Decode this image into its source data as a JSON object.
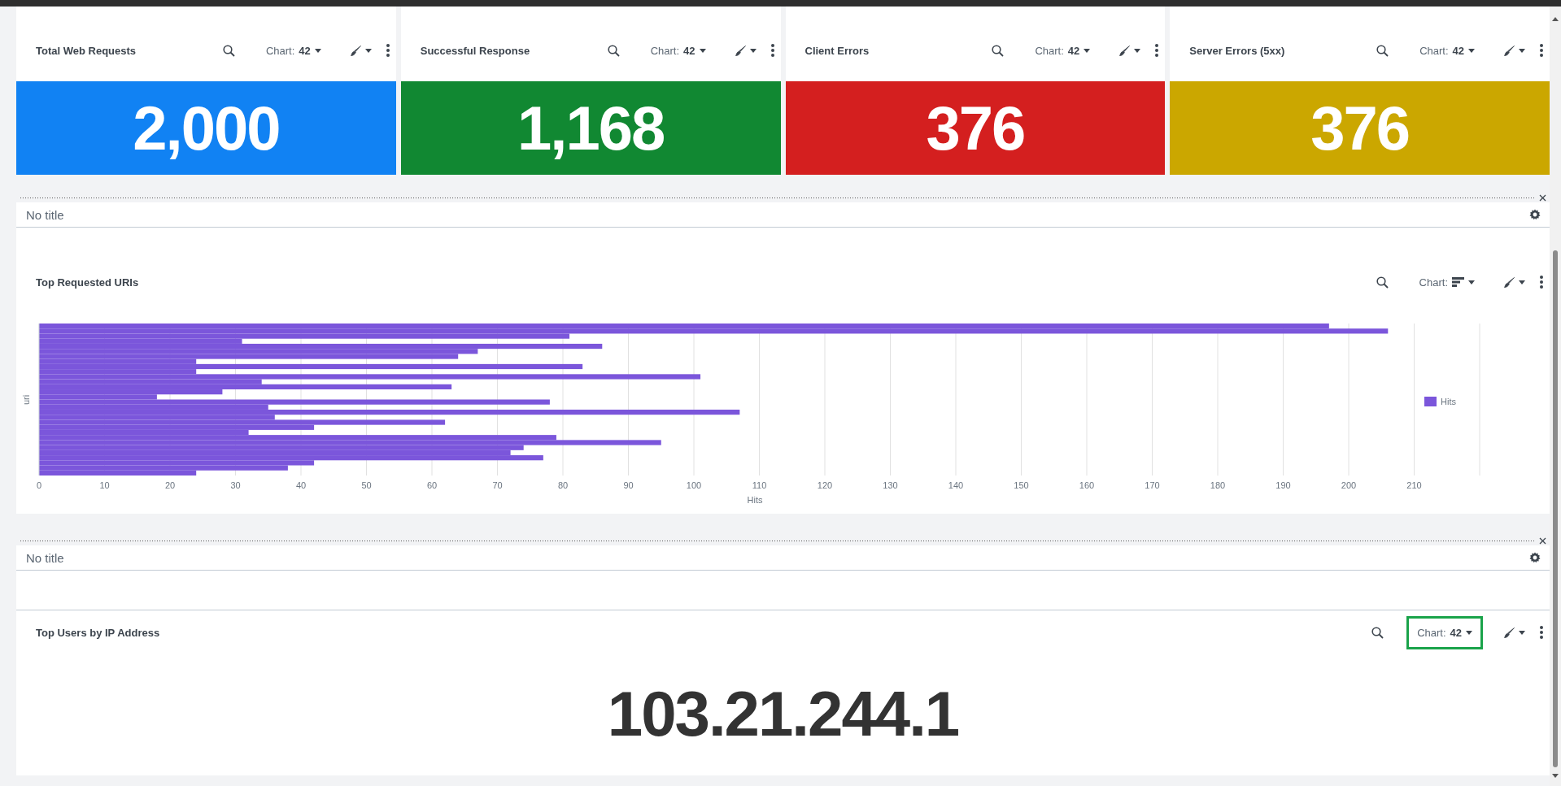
{
  "stat_cards": [
    {
      "title": "Total Web Requests",
      "chart_button": {
        "label": "Chart:",
        "value": "42",
        "highlighted": false
      },
      "value": "2,000",
      "color": "#1182f3"
    },
    {
      "title": "Successful Response",
      "chart_button": {
        "label": "Chart:",
        "value": "42",
        "highlighted": false
      },
      "value": "1,168",
      "color": "#118832"
    },
    {
      "title": "Client Errors",
      "chart_button": {
        "label": "Chart:",
        "value": "42",
        "highlighted": false
      },
      "value": "376",
      "color": "#d41f1f"
    },
    {
      "title": "Server Errors (5xx)",
      "chart_button": {
        "label": "Chart:",
        "value": "42",
        "highlighted": false
      },
      "value": "376",
      "color": "#cba700"
    }
  ],
  "sections": [
    {
      "title": "No title",
      "panels": [
        {
          "kind": "chart",
          "title": "Top Requested URIs",
          "chart_button": {
            "label": "Chart:",
            "highlighted": false
          },
          "chart_data": {
            "type": "bar",
            "orientation": "horizontal",
            "grid": true,
            "xlabel": "Hits",
            "ylabel": "uri",
            "xlim": [
              0,
              220
            ],
            "xticks": [
              0,
              10,
              20,
              30,
              40,
              50,
              60,
              70,
              80,
              90,
              100,
              110,
              120,
              130,
              140,
              150,
              160,
              170,
              180,
              190,
              200,
              210
            ],
            "series": [
              {
                "name": "Hits",
                "color": "#7b56db",
                "values": [
                  197,
                  206,
                  81,
                  31,
                  86,
                  67,
                  64,
                  24,
                  83,
                  24,
                  101,
                  34,
                  63,
                  28,
                  18,
                  78,
                  35,
                  107,
                  36,
                  62,
                  42,
                  32,
                  79,
                  95,
                  74,
                  72,
                  77,
                  42,
                  38,
                  24
                ]
              }
            ]
          }
        }
      ]
    },
    {
      "title": "No title",
      "panels": [
        {
          "kind": "single_value",
          "title": "Top Users by IP Address",
          "chart_button": {
            "label": "Chart:",
            "value": "42",
            "highlighted": true
          },
          "value": "103.21.244.1"
        }
      ]
    }
  ]
}
